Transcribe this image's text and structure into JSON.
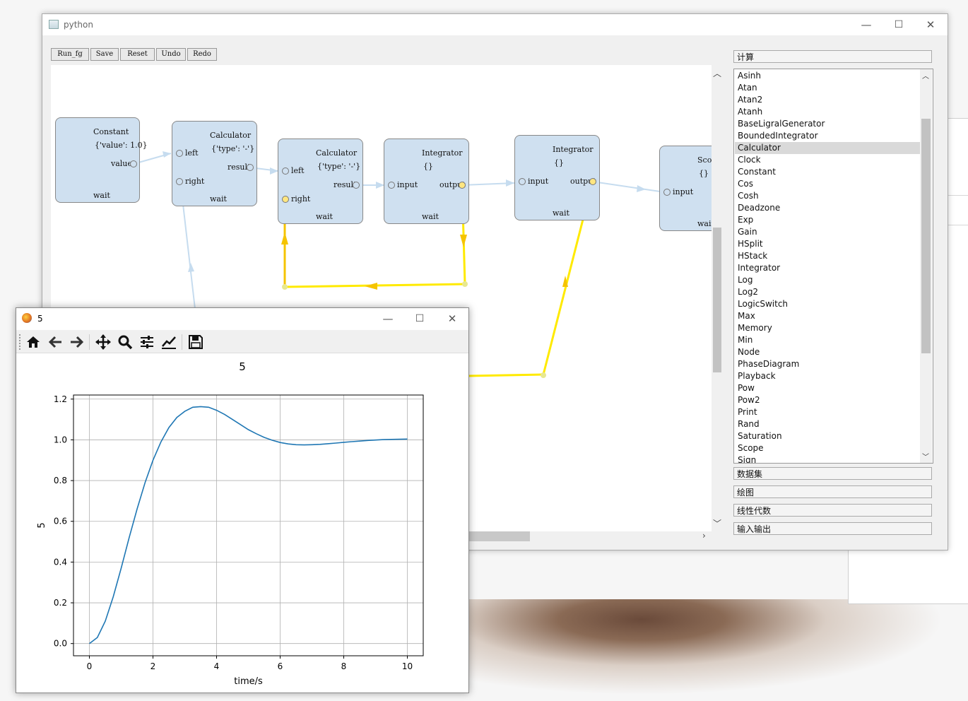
{
  "main_window": {
    "title": "python",
    "controls": {
      "minimize": "—",
      "maximize": "☐",
      "close": "✕"
    }
  },
  "toolbar": {
    "run_label": "Run_fg",
    "save_label": "Save",
    "reset_label": "Reset",
    "undo_label": "Undo",
    "redo_label": "Redo"
  },
  "graph": {
    "nodes": [
      {
        "name": "Constant",
        "params": "{'value': 1.0}",
        "ports_out": [
          "value"
        ],
        "status": "wait"
      },
      {
        "name": "Calculator",
        "params": "{'type': '-'}",
        "ports_in": [
          "left",
          "right"
        ],
        "ports_out": [
          "result"
        ],
        "status": "wait"
      },
      {
        "name": "Calculator",
        "params": "{'type': '-'}",
        "ports_in": [
          "left",
          "right"
        ],
        "ports_out": [
          "result"
        ],
        "status": "wait"
      },
      {
        "name": "Integrator",
        "params": "{}",
        "ports_in": [
          "input"
        ],
        "ports_out": [
          "output"
        ],
        "status": "wait"
      },
      {
        "name": "Integrator",
        "params": "{}",
        "ports_in": [
          "input"
        ],
        "ports_out": [
          "output"
        ],
        "status": "wait"
      },
      {
        "name": "Scope",
        "params": "{}",
        "ports_in": [
          "input"
        ],
        "status": "wait"
      }
    ]
  },
  "panel": {
    "sections": [
      "计算",
      "数据集",
      "绘图",
      "线性代数",
      "输入输出"
    ],
    "items": [
      "Asinh",
      "Atan",
      "Atan2",
      "Atanh",
      "BaseLigralGenerator",
      "BoundedIntegrator",
      "Calculator",
      "Clock",
      "Constant",
      "Cos",
      "Cosh",
      "Deadzone",
      "Exp",
      "Gain",
      "HSplit",
      "HStack",
      "Integrator",
      "Log",
      "Log2",
      "LogicSwitch",
      "Max",
      "Memory",
      "Min",
      "Node",
      "PhaseDiagram",
      "Playback",
      "Pow",
      "Pow2",
      "Print",
      "Rand",
      "Saturation",
      "Scope",
      "Sign"
    ],
    "selected": "Calculator"
  },
  "plot_window": {
    "title": "5",
    "controls": {
      "minimize": "—",
      "maximize": "☐",
      "close": "✕"
    },
    "toolbar_icons": [
      "home-icon",
      "back-arrow-icon",
      "forward-arrow-icon",
      "pan-icon",
      "zoom-icon",
      "configure-subplots-icon",
      "edit-axis-icon",
      "save-icon"
    ]
  },
  "chart_data": {
    "type": "line",
    "title": "5",
    "xlabel": "time/s",
    "ylabel": "5",
    "xlim": [
      -0.5,
      10.5
    ],
    "ylim": [
      -0.06,
      1.22
    ],
    "xticks": [
      0,
      2,
      4,
      6,
      8,
      10
    ],
    "yticks": [
      0.0,
      0.2,
      0.4,
      0.6,
      0.8,
      1.0,
      1.2
    ],
    "ytick_labels": [
      "0.0",
      "0.2",
      "0.4",
      "0.6",
      "0.8",
      "1.0",
      "1.2"
    ],
    "grid": true,
    "color": "#1f77b4",
    "series": [
      {
        "x": [
          0,
          0.25,
          0.5,
          0.75,
          1,
          1.25,
          1.5,
          1.75,
          2,
          2.25,
          2.5,
          2.75,
          3,
          3.25,
          3.5,
          3.75,
          4,
          4.25,
          4.5,
          4.75,
          5,
          5.25,
          5.5,
          5.75,
          6,
          6.25,
          6.5,
          6.75,
          7,
          7.25,
          7.5,
          7.75,
          8,
          8.25,
          8.5,
          8.75,
          9,
          9.25,
          9.5,
          9.75,
          10
        ],
        "y": [
          0.0,
          0.03,
          0.11,
          0.23,
          0.37,
          0.52,
          0.66,
          0.79,
          0.9,
          0.99,
          1.06,
          1.11,
          1.14,
          1.16,
          1.163,
          1.16,
          1.145,
          1.125,
          1.1,
          1.075,
          1.05,
          1.03,
          1.012,
          0.998,
          0.987,
          0.98,
          0.976,
          0.975,
          0.976,
          0.978,
          0.981,
          0.984,
          0.988,
          0.991,
          0.994,
          0.997,
          0.999,
          1.001,
          1.002,
          1.003,
          1.004
        ]
      }
    ]
  }
}
